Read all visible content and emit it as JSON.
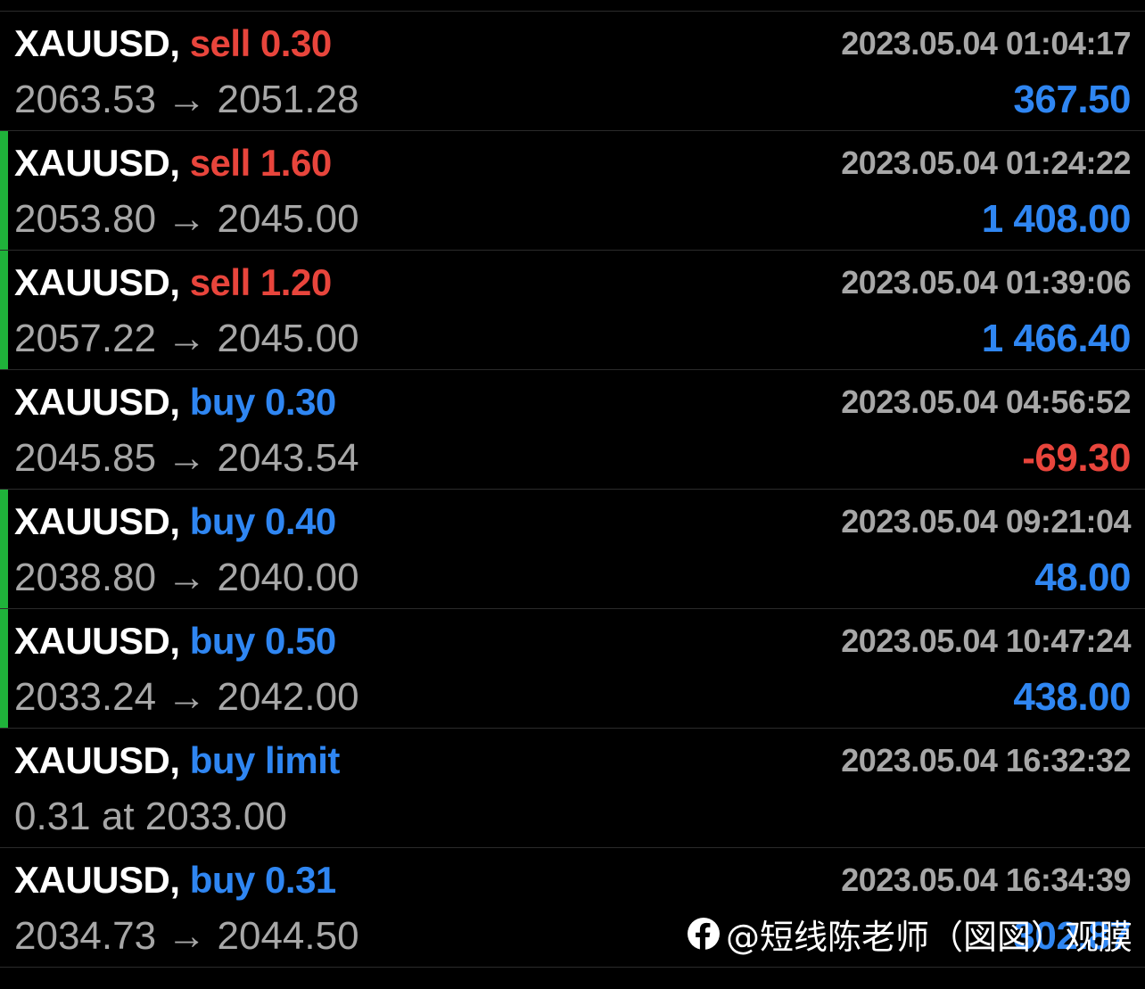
{
  "orders": [
    {
      "symbol": "XAUUSD,",
      "op": "sell 0.30",
      "op_type": "sell",
      "time": "2023.05.04 01:04:17",
      "prices": "2063.53 → 2051.28",
      "profit": "367.50",
      "profit_sign": "pos",
      "accent": false
    },
    {
      "symbol": "XAUUSD,",
      "op": "sell 1.60",
      "op_type": "sell",
      "time": "2023.05.04 01:24:22",
      "prices": "2053.80 → 2045.00",
      "profit": "1 408.00",
      "profit_sign": "pos",
      "accent": true
    },
    {
      "symbol": "XAUUSD,",
      "op": "sell 1.20",
      "op_type": "sell",
      "time": "2023.05.04 01:39:06",
      "prices": "2057.22 → 2045.00",
      "profit": "1 466.40",
      "profit_sign": "pos",
      "accent": true
    },
    {
      "symbol": "XAUUSD,",
      "op": "buy 0.30",
      "op_type": "buy",
      "time": "2023.05.04 04:56:52",
      "prices": "2045.85 → 2043.54",
      "profit": "-69.30",
      "profit_sign": "neg",
      "accent": false
    },
    {
      "symbol": "XAUUSD,",
      "op": "buy 0.40",
      "op_type": "buy",
      "time": "2023.05.04 09:21:04",
      "prices": "2038.80 → 2040.00",
      "profit": "48.00",
      "profit_sign": "pos",
      "accent": true
    },
    {
      "symbol": "XAUUSD,",
      "op": "buy 0.50",
      "op_type": "buy",
      "time": "2023.05.04 10:47:24",
      "prices": "2033.24 → 2042.00",
      "profit": "438.00",
      "profit_sign": "pos",
      "accent": true
    },
    {
      "symbol": "XAUUSD,",
      "op": "buy limit",
      "op_type": "buy",
      "time": "2023.05.04 16:32:32",
      "prices": "0.31 at 2033.00",
      "profit": "",
      "profit_sign": "pos",
      "accent": false
    },
    {
      "symbol": "XAUUSD,",
      "op": "buy 0.31",
      "op_type": "buy",
      "time": "2023.05.04 16:34:39",
      "prices": "2034.73 → 2044.50",
      "profit": "302.87",
      "profit_sign": "pos",
      "accent": false
    }
  ],
  "watermark": {
    "icon": "facebook-icon",
    "text": "@短线陈老师（図図）观膜"
  },
  "colors": {
    "sell": "#e8453c",
    "buy": "#2f86f2",
    "positive": "#2f86f2",
    "negative": "#e8453c",
    "accent": "#1fb23a"
  }
}
